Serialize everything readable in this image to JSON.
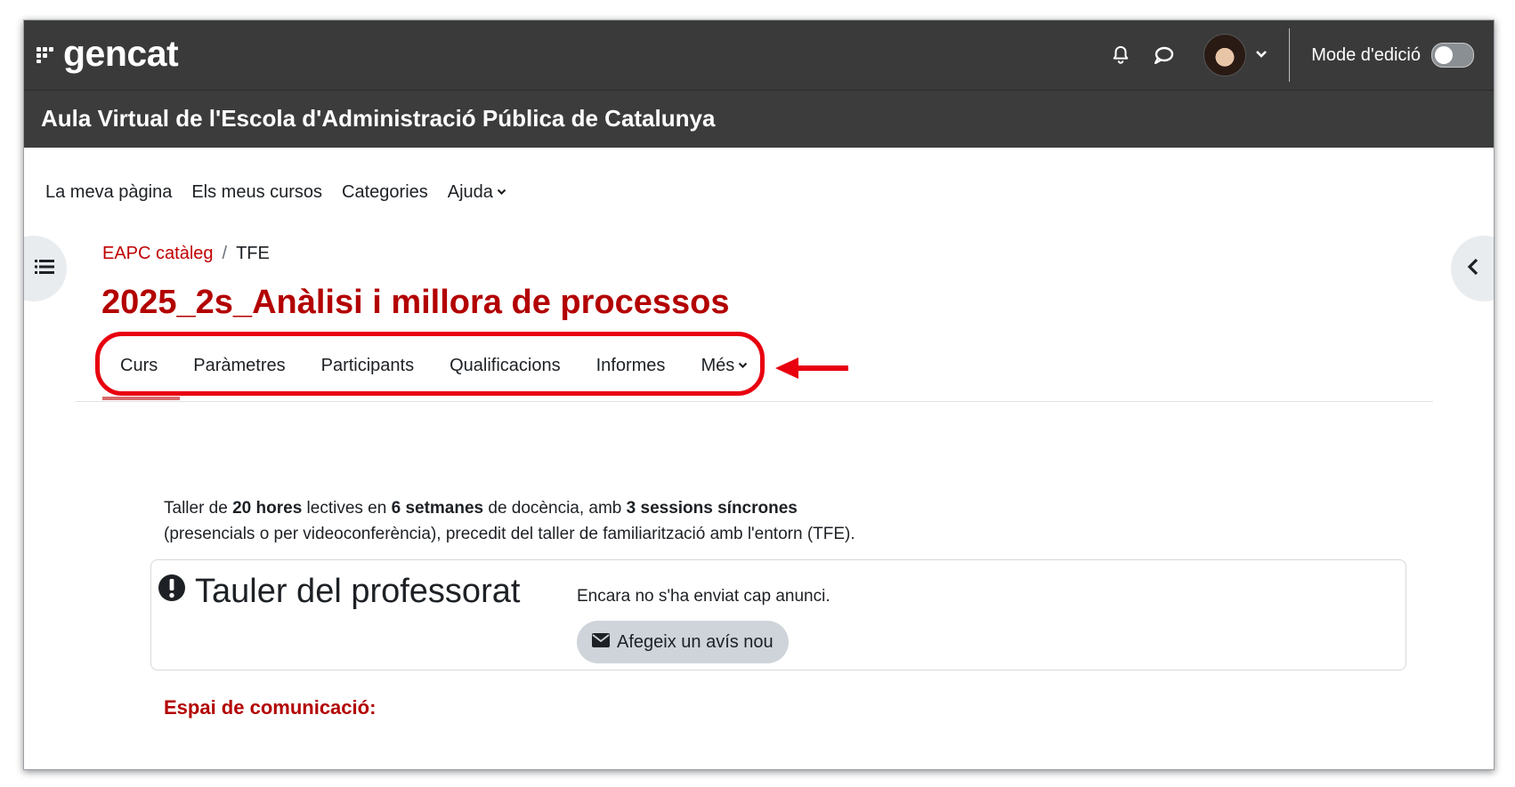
{
  "brand": {
    "logo_text": "gencat"
  },
  "top_bar": {
    "edit_mode_label": "Mode d'edició",
    "edit_mode_on": false
  },
  "site": {
    "title": "Aula Virtual de l'Escola d'Administració Pública de Catalunya"
  },
  "primary_nav": {
    "items": [
      {
        "label": "La meva pàgina"
      },
      {
        "label": "Els meus cursos"
      },
      {
        "label": "Categories"
      },
      {
        "label": "Ajuda"
      }
    ]
  },
  "breadcrumb": {
    "parent": "EAPC catàleg",
    "separator": "/",
    "current": "TFE"
  },
  "page": {
    "title": "2025_2s_Anàlisi i millora de processos"
  },
  "secondary_nav": {
    "tabs": [
      {
        "label": "Curs",
        "active": true
      },
      {
        "label": "Paràmetres"
      },
      {
        "label": "Participants"
      },
      {
        "label": "Qualificacions"
      },
      {
        "label": "Informes"
      },
      {
        "label": "Més"
      }
    ]
  },
  "intro": {
    "p1": "Taller de ",
    "b1": "20 hores",
    "p2": " lectives en ",
    "b2": "6 setmanes",
    "p3": " de docència, amb ",
    "b3": "3 sessions síncrones",
    "line2": "(presencials o per videoconferència), precedit del taller de familiarització amb l'entorn (TFE)."
  },
  "teacher_board": {
    "title": "Tauler del professorat",
    "empty_message": "Encara no s'ha enviat cap anunci.",
    "add_button": "Afegeix un avís nou"
  },
  "communication": {
    "heading": "Espai de comunicació:"
  },
  "colors": {
    "navbar_bg": "#3a3a3a",
    "accent_red": "#b30000",
    "link_red": "#c00000",
    "annotation_red": "#e8000f"
  },
  "icons": [
    "gencat-logo-icon",
    "bell-icon",
    "chat-icon",
    "chevron-down-icon",
    "course-index-icon",
    "chevron-left-icon",
    "exclamation-circle-icon",
    "envelope-icon",
    "arrow-left-icon"
  ]
}
